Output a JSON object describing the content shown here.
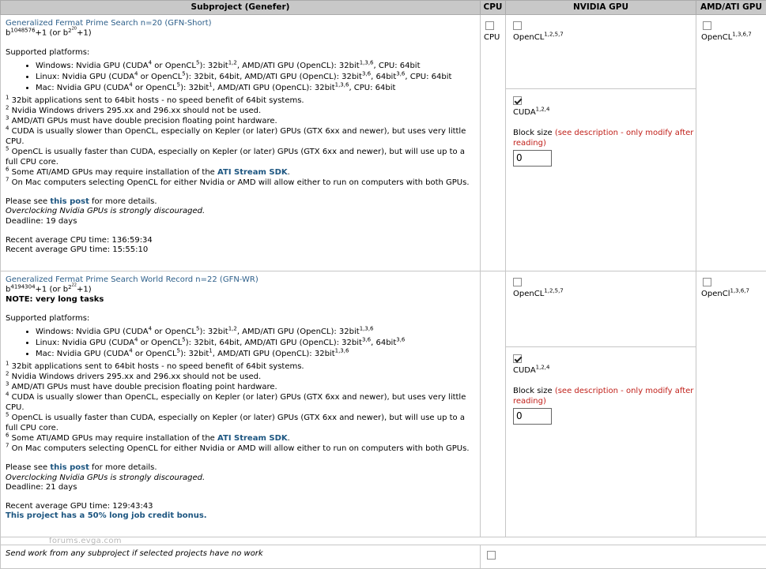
{
  "headers": {
    "subproject": "Subproject (Genefer)",
    "cpu": "CPU",
    "nvidia": "NVIDIA GPU",
    "amd": "AMD/ATI GPU"
  },
  "gfn_short": {
    "title": "Generalized Fermat Prime Search n=20 (GFN-Short)",
    "formula_base": "b",
    "formula_exp": "1048576",
    "formula_mid": "+1 (or b",
    "formula_exp2": "2",
    "formula_exp2b": "20",
    "formula_end": "+1)",
    "supported_label": "Supported platforms:",
    "platforms": [
      {
        "text1": "Windows: Nvidia GPU (CUDA",
        "s1": "4",
        "text2": " or OpenCL",
        "s2": "5",
        "text3": "): 32bit",
        "s3": "1,2",
        "text4": ", AMD/ATI GPU (OpenCL): 32bit",
        "s4": "1,3,6",
        "text5": ", CPU: 64bit"
      },
      {
        "text1": "Linux: Nvidia GPU (CUDA",
        "s1": "4",
        "text2": " or OpenCL",
        "s2": "5",
        "text3": "): 32bit, 64bit, AMD/ATI GPU (OpenCL): 32bit",
        "s3": "3,6",
        "text4": ", 64bit",
        "s4": "3,6",
        "text5": ", CPU: 64bit"
      },
      {
        "text1": "Mac: Nvidia GPU (CUDA",
        "s1": "4",
        "text2": " or OpenCL",
        "s2": "5",
        "text3": "): 32bit",
        "s3": "1",
        "text4": ", AMD/ATI GPU (OpenCL): 32bit",
        "s4": "1,3,6",
        "text5": ", CPU: 64bit"
      }
    ],
    "deadline": "Deadline: 19 days",
    "cpu_time": "Recent average CPU time: 136:59:34",
    "gpu_time": "Recent average GPU time: 15:55:10"
  },
  "gfn_wr": {
    "title": "Generalized Fermat Prime Search World Record n=22 (GFN-WR)",
    "formula_base": "b",
    "formula_exp": "4194304",
    "formula_mid": "+1 (or b",
    "formula_exp2": "2",
    "formula_exp2b": "22",
    "formula_end": "+1)",
    "note": "NOTE: very long tasks",
    "supported_label": "Supported platforms:",
    "platforms": [
      {
        "text1": "Windows: Nvidia GPU (CUDA",
        "s1": "4",
        "text2": " or OpenCL",
        "s2": "5",
        "text3": "): 32bit",
        "s3": "1,2",
        "text4": ", AMD/ATI GPU (OpenCL): 32bit",
        "s4": "1,3,6",
        "text5": ""
      },
      {
        "text1": "Linux: Nvidia GPU (CUDA",
        "s1": "4",
        "text2": " or OpenCL",
        "s2": "5",
        "text3": "): 32bit, 64bit, AMD/ATI GPU (OpenCL): 32bit",
        "s3": "3,6",
        "text4": ", 64bit",
        "s4": "3,6",
        "text5": ""
      },
      {
        "text1": "Mac: Nvidia GPU (CUDA",
        "s1": "4",
        "text2": " or OpenCL",
        "s2": "5",
        "text3": "): 32bit",
        "s3": "1",
        "text4": ", AMD/ATI GPU (OpenCL): 32bit",
        "s4": "1,3,6",
        "text5": ""
      }
    ],
    "deadline": "Deadline: 21 days",
    "gpu_time": "Recent average GPU time: 129:43:43",
    "bonus": "This project has a 50% long job credit bonus."
  },
  "footnotes": [
    {
      "n": "1",
      "text": "32bit applications sent to 64bit hosts - no speed benefit of 64bit systems."
    },
    {
      "n": "2",
      "text": "Nvidia Windows drivers 295.xx and 296.xx should not be used."
    },
    {
      "n": "3",
      "text": "AMD/ATI GPUs must have double precision floating point hardware."
    },
    {
      "n": "4",
      "text": "CUDA is usually slower than OpenCL, especially on Kepler (or later) GPUs (GTX 6xx and newer), but uses very little CPU."
    },
    {
      "n": "5",
      "text": "OpenCL is usually faster than CUDA, especially on Kepler (or later) GPUs (GTX 6xx and newer), but will use up to a full CPU core."
    },
    {
      "n": "6",
      "text_before": "Some ATI/AMD GPUs may require installation of the ",
      "link": "ATI Stream SDK",
      "text_after": "."
    },
    {
      "n": "7",
      "text": "On Mac computers selecting OpenCL for either Nvidia or AMD will allow either to run on computers with both GPUs."
    }
  ],
  "post_text_before": "Please see ",
  "post_link": "this post",
  "post_text_after": " for more details.",
  "overclock": "Overclocking Nvidia GPUs is strongly discouraged.",
  "options": {
    "cpu_label": "CPU",
    "opencl_nv_label": "OpenCL",
    "opencl_nv_sup": "1,2,5,7",
    "cuda_label": "CUDA",
    "cuda_sup": "1,2,4",
    "block_size_label": "Block size",
    "block_size_note": "(see description - only modify after reading)",
    "block_size_paren_close": ")",
    "block_size_value": "0",
    "opencl_amd_short": "OpenCL",
    "opencl_amd_wr": "OpenCl",
    "opencl_amd_sup": "1,3,6,7"
  },
  "state": {
    "short_cpu": false,
    "short_opencl_nv": false,
    "short_cuda": true,
    "short_opencl_amd": false,
    "wr_opencl_nv": false,
    "wr_cuda": true,
    "wr_opencl_amd": false,
    "any_work": false
  },
  "any_work_label": "Send work from any subproject if selected projects have no work",
  "watermark": "forums.evga.com"
}
